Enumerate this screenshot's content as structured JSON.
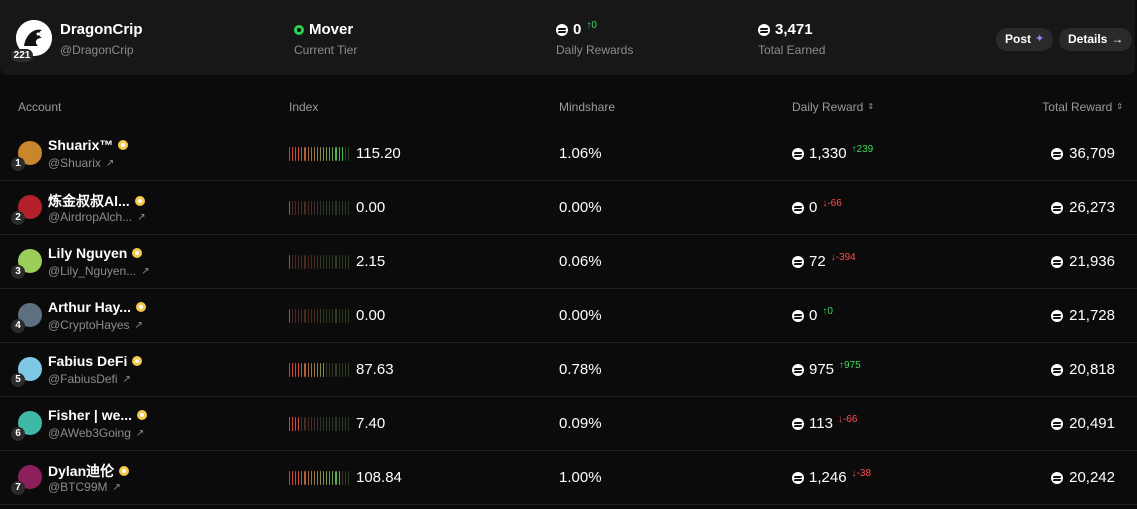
{
  "profile": {
    "name": "DragonCrip",
    "handle": "@DragonCrip",
    "rank": "221",
    "tier": "Mover",
    "tier_label": "Current Tier",
    "daily_rewards": "0",
    "daily_rewards_delta": "0",
    "daily_rewards_label": "Daily Rewards",
    "total_earned": "3,471",
    "total_earned_label": "Total Earned",
    "post_button": "Post",
    "details_button": "Details"
  },
  "table": {
    "headers": {
      "account": "Account",
      "index": "Index",
      "mindshare": "Mindshare",
      "daily_reward": "Daily Reward",
      "total_reward": "Total Reward"
    },
    "rows": [
      {
        "rank": "1",
        "name": "Shuarix™",
        "handle": "@Shuarix",
        "index": "115.20",
        "index_level": 0.88,
        "mindshare": "1.06%",
        "daily": "1,330",
        "delta": "239",
        "delta_dir": "up",
        "total": "36,709",
        "avatar_color": "#c9862c"
      },
      {
        "rank": "2",
        "name": "炼金叔叔Al...",
        "handle": "@AirdropAlch...",
        "index": "0.00",
        "index_level": 0.0,
        "mindshare": "0.00%",
        "daily": "0",
        "delta": "-66",
        "delta_dir": "down",
        "total": "26,273",
        "avatar_color": "#b3202a"
      },
      {
        "rank": "3",
        "name": "Lily Nguyen",
        "handle": "@Lily_Nguyen...",
        "index": "2.15",
        "index_level": 0.05,
        "mindshare": "0.06%",
        "daily": "72",
        "delta": "-394",
        "delta_dir": "down",
        "total": "21,936",
        "avatar_color": "#9acd5a"
      },
      {
        "rank": "4",
        "name": "Arthur Hay...",
        "handle": "@CryptoHayes",
        "index": "0.00",
        "index_level": 0.0,
        "mindshare": "0.00%",
        "daily": "0",
        "delta": "0",
        "delta_dir": "up",
        "total": "21,728",
        "avatar_color": "#5e7080"
      },
      {
        "rank": "5",
        "name": "Fabius DeFi",
        "handle": "@FabiusDefi",
        "index": "87.63",
        "index_level": 0.62,
        "mindshare": "0.78%",
        "daily": "975",
        "delta": "975",
        "delta_dir": "up",
        "total": "20,818",
        "avatar_color": "#7ec8e6"
      },
      {
        "rank": "6",
        "name": "Fisher | we...",
        "handle": "@AWeb3Going",
        "index": "7.40",
        "index_level": 0.2,
        "mindshare": "0.09%",
        "daily": "113",
        "delta": "-66",
        "delta_dir": "down",
        "total": "20,491",
        "avatar_color": "#3fb8a6"
      },
      {
        "rank": "7",
        "name": "Dylan迪伦",
        "handle": "@BTC99M",
        "index": "108.84",
        "index_level": 0.85,
        "mindshare": "1.00%",
        "daily": "1,246",
        "delta": "-38",
        "delta_dir": "down",
        "total": "20,242",
        "avatar_color": "#8a1f5a"
      }
    ]
  },
  "colors": {
    "background": "#0b0b0b",
    "card": "#171717",
    "up": "#3ddc5a",
    "down": "#ff4d4d",
    "bar_red": "#e0392f",
    "bar_dim": "#4a2a22",
    "bar_green": "#34d057"
  },
  "icons": {
    "coin": "reward-coin-icon",
    "sort": "sort-chevrons-icon",
    "external": "external-link-icon",
    "verified": "verified-badge-icon",
    "sparkle": "sparkle-icon",
    "arrow": "arrow-right-icon"
  }
}
